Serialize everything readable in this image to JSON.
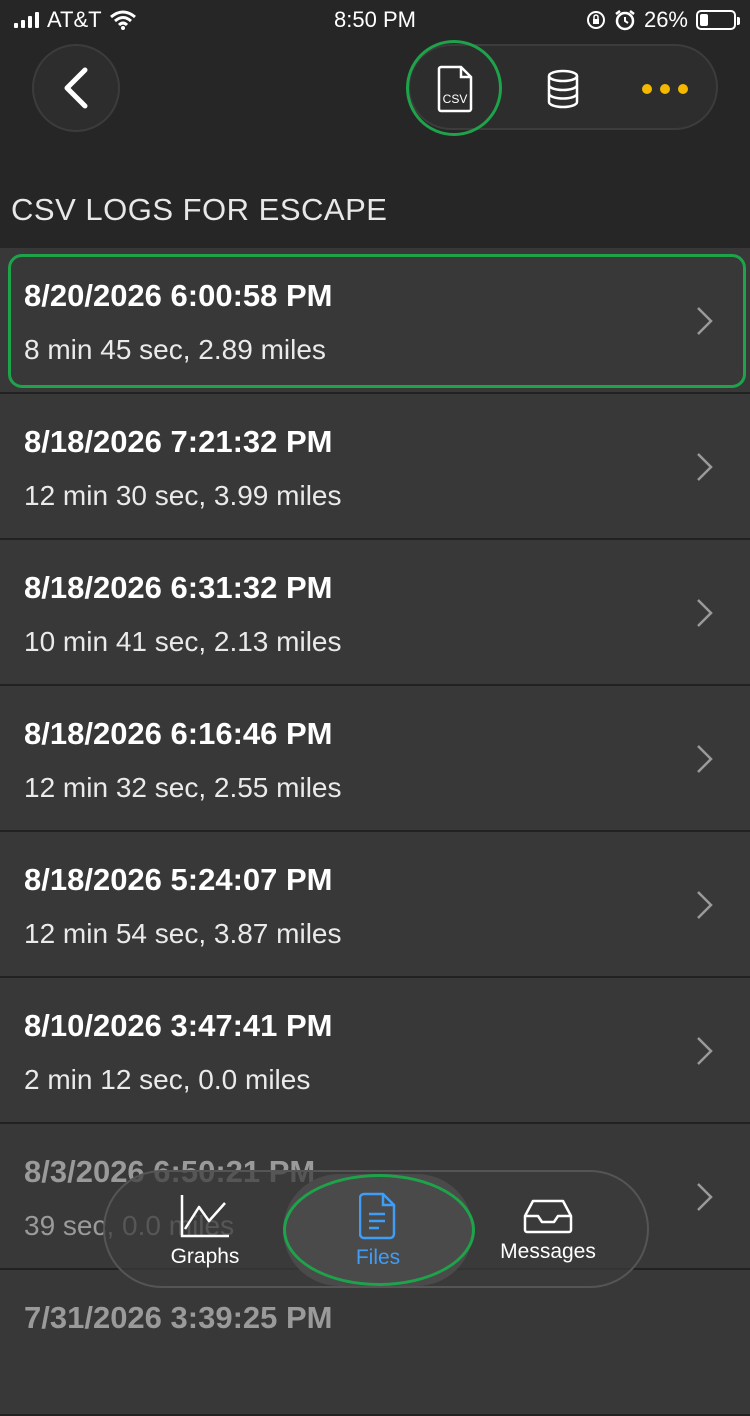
{
  "status_bar": {
    "carrier": "AT&T",
    "time": "8:50 PM",
    "battery_percent": "26%",
    "battery_level": 0.26,
    "icons": [
      "signal-icon",
      "wifi-icon",
      "orientation-lock-icon",
      "alarm-icon",
      "battery-icon"
    ]
  },
  "top_bar": {
    "back_icon": "chevron-left-icon",
    "csv_label": "CSV",
    "db_icon": "database-icon",
    "more_icon": "more-dots-icon",
    "accent": "#f5b800"
  },
  "section": {
    "title": "CSV LOGS FOR ESCAPE"
  },
  "logs": [
    {
      "title": "8/20/2026 6:00:58 PM",
      "subtitle": "8 min 45 sec, 2.89 miles"
    },
    {
      "title": "8/18/2026 7:21:32 PM",
      "subtitle": "12 min 30 sec, 3.99 miles"
    },
    {
      "title": "8/18/2026 6:31:32 PM",
      "subtitle": "10 min 41 sec, 2.13 miles"
    },
    {
      "title": "8/18/2026 6:16:46 PM",
      "subtitle": "12 min 32 sec, 2.55 miles"
    },
    {
      "title": "8/18/2026 5:24:07 PM",
      "subtitle": "12 min 54 sec, 3.87 miles"
    },
    {
      "title": "8/10/2026 3:47:41 PM",
      "subtitle": "2 min 12 sec, 0.0 miles"
    },
    {
      "title": "8/3/2026 6:50:21 PM",
      "subtitle": "39 sec, 0.0 miles"
    },
    {
      "title": "7/31/2026 3:39:25 PM",
      "subtitle": ""
    }
  ],
  "tabs": {
    "graphs": "Graphs",
    "files": "Files",
    "messages": "Messages",
    "active_color": "#3f9df5"
  },
  "highlight_color": "#1ea24a"
}
